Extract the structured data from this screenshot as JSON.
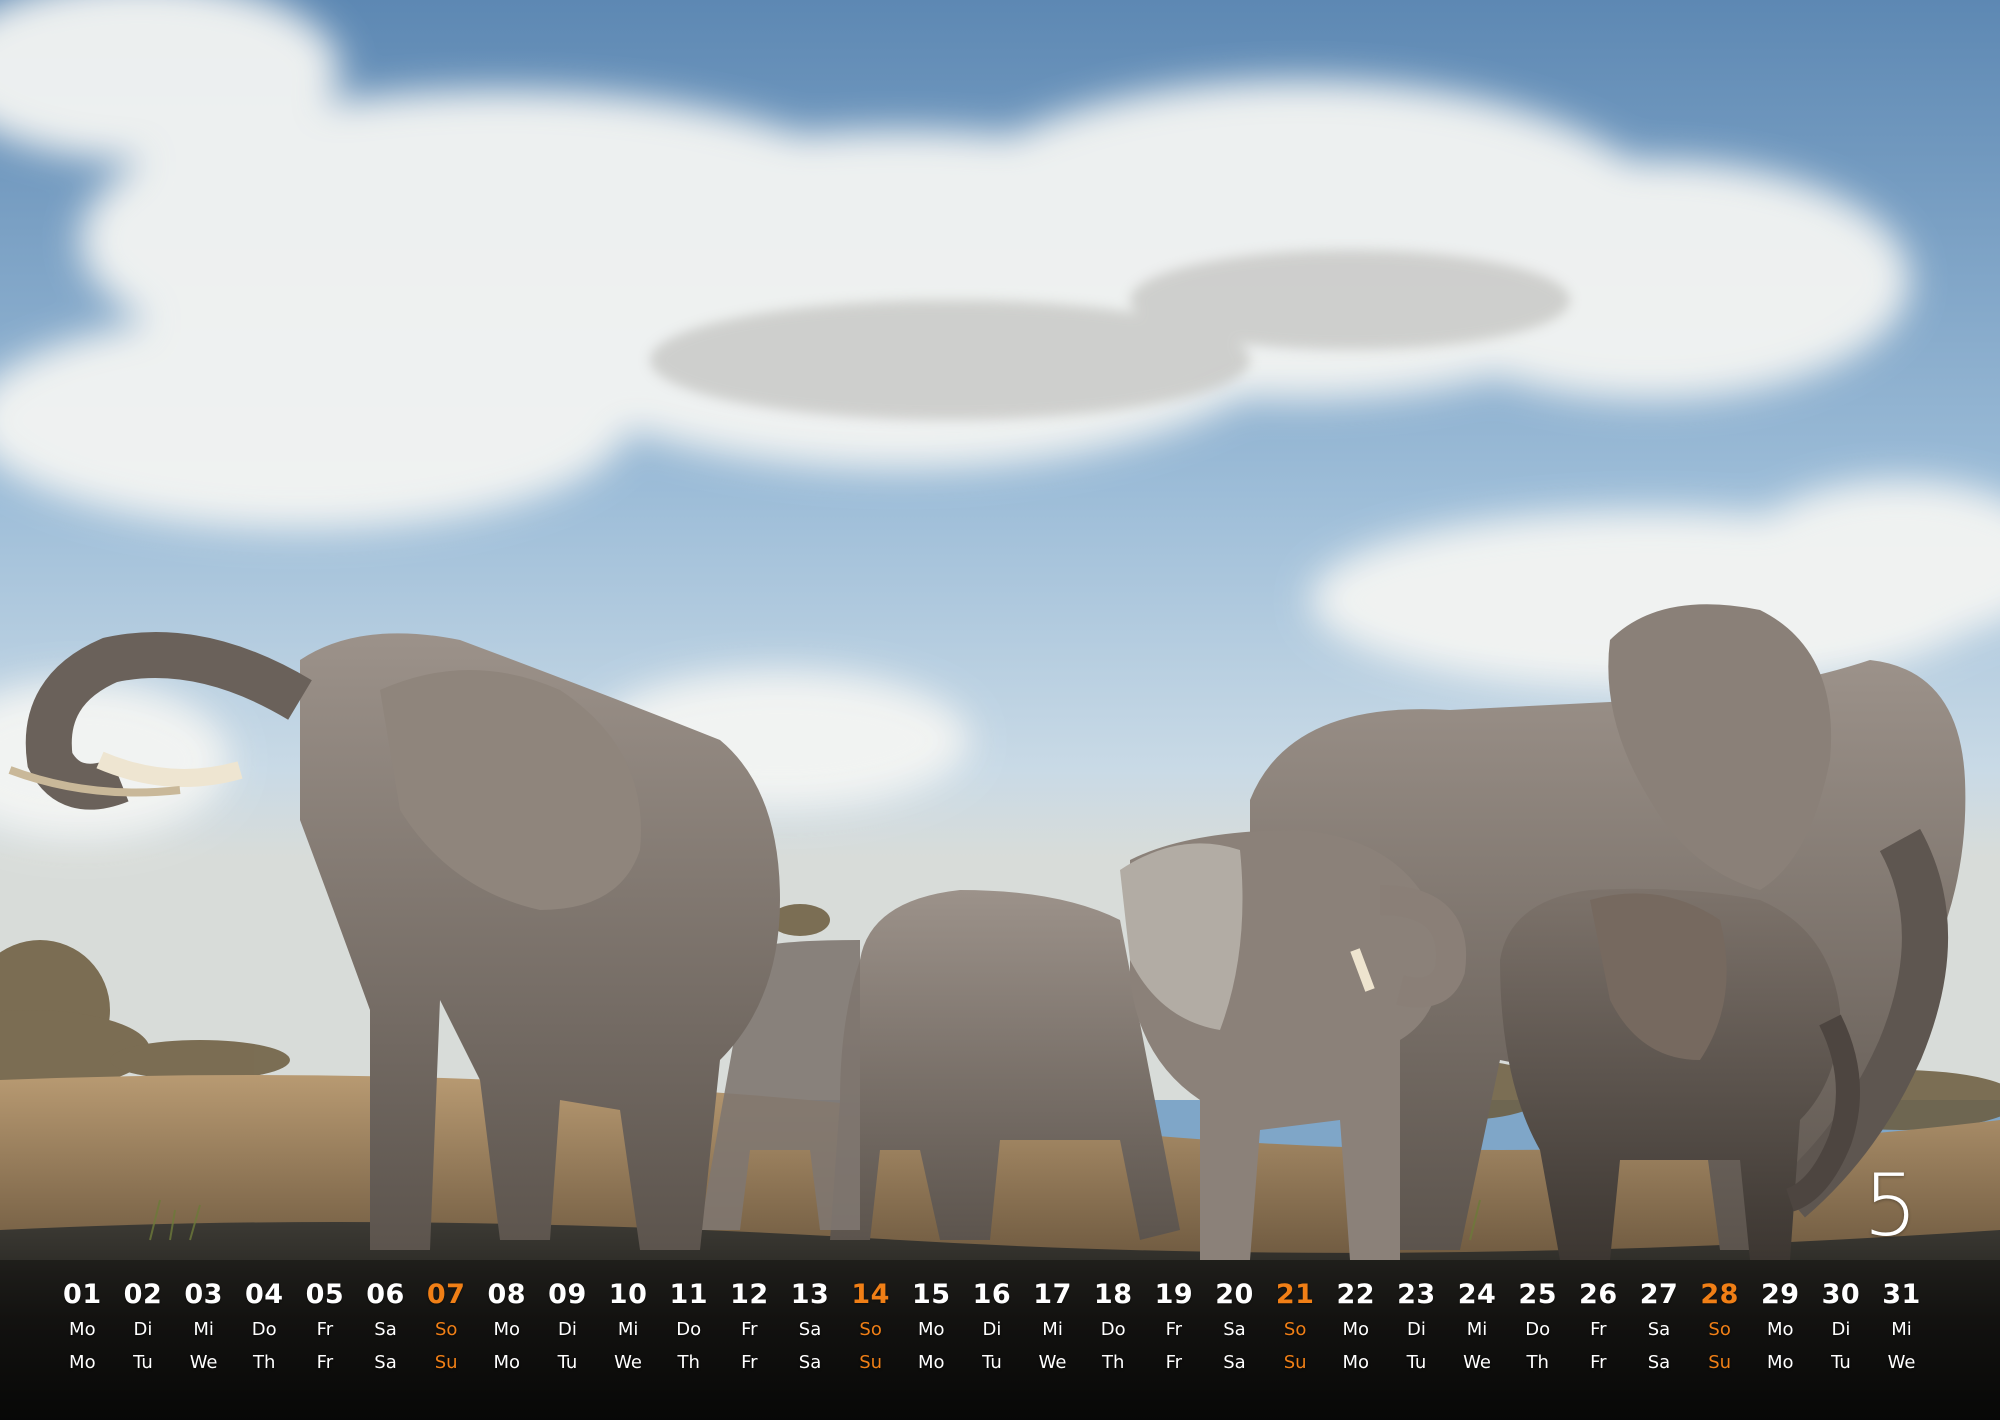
{
  "calendar": {
    "month_number": "5",
    "accent_color": "#f07f16",
    "text_color": "#ffffff",
    "days": [
      {
        "num": "01",
        "de": "Mo",
        "en": "Mo",
        "sunday": false
      },
      {
        "num": "02",
        "de": "Di",
        "en": "Tu",
        "sunday": false
      },
      {
        "num": "03",
        "de": "Mi",
        "en": "We",
        "sunday": false
      },
      {
        "num": "04",
        "de": "Do",
        "en": "Th",
        "sunday": false
      },
      {
        "num": "05",
        "de": "Fr",
        "en": "Fr",
        "sunday": false
      },
      {
        "num": "06",
        "de": "Sa",
        "en": "Sa",
        "sunday": false
      },
      {
        "num": "07",
        "de": "So",
        "en": "Su",
        "sunday": true
      },
      {
        "num": "08",
        "de": "Mo",
        "en": "Mo",
        "sunday": false
      },
      {
        "num": "09",
        "de": "Di",
        "en": "Tu",
        "sunday": false
      },
      {
        "num": "10",
        "de": "Mi",
        "en": "We",
        "sunday": false
      },
      {
        "num": "11",
        "de": "Do",
        "en": "Th",
        "sunday": false
      },
      {
        "num": "12",
        "de": "Fr",
        "en": "Fr",
        "sunday": false
      },
      {
        "num": "13",
        "de": "Sa",
        "en": "Sa",
        "sunday": false
      },
      {
        "num": "14",
        "de": "So",
        "en": "Su",
        "sunday": true
      },
      {
        "num": "15",
        "de": "Mo",
        "en": "Mo",
        "sunday": false
      },
      {
        "num": "16",
        "de": "Di",
        "en": "Tu",
        "sunday": false
      },
      {
        "num": "17",
        "de": "Mi",
        "en": "We",
        "sunday": false
      },
      {
        "num": "18",
        "de": "Do",
        "en": "Th",
        "sunday": false
      },
      {
        "num": "19",
        "de": "Fr",
        "en": "Fr",
        "sunday": false
      },
      {
        "num": "20",
        "de": "Sa",
        "en": "Sa",
        "sunday": false
      },
      {
        "num": "21",
        "de": "So",
        "en": "Su",
        "sunday": true
      },
      {
        "num": "22",
        "de": "Mo",
        "en": "Mo",
        "sunday": false
      },
      {
        "num": "23",
        "de": "Di",
        "en": "Tu",
        "sunday": false
      },
      {
        "num": "24",
        "de": "Mi",
        "en": "We",
        "sunday": false
      },
      {
        "num": "25",
        "de": "Do",
        "en": "Th",
        "sunday": false
      },
      {
        "num": "26",
        "de": "Fr",
        "en": "Fr",
        "sunday": false
      },
      {
        "num": "27",
        "de": "Sa",
        "en": "Sa",
        "sunday": false
      },
      {
        "num": "28",
        "de": "So",
        "en": "Su",
        "sunday": true
      },
      {
        "num": "29",
        "de": "Mo",
        "en": "Mo",
        "sunday": false
      },
      {
        "num": "30",
        "de": "Di",
        "en": "Tu",
        "sunday": false
      },
      {
        "num": "31",
        "de": "Mi",
        "en": "We",
        "sunday": false
      }
    ]
  },
  "photo": {
    "subject": "elephant-herd-at-waterhole-icon"
  }
}
